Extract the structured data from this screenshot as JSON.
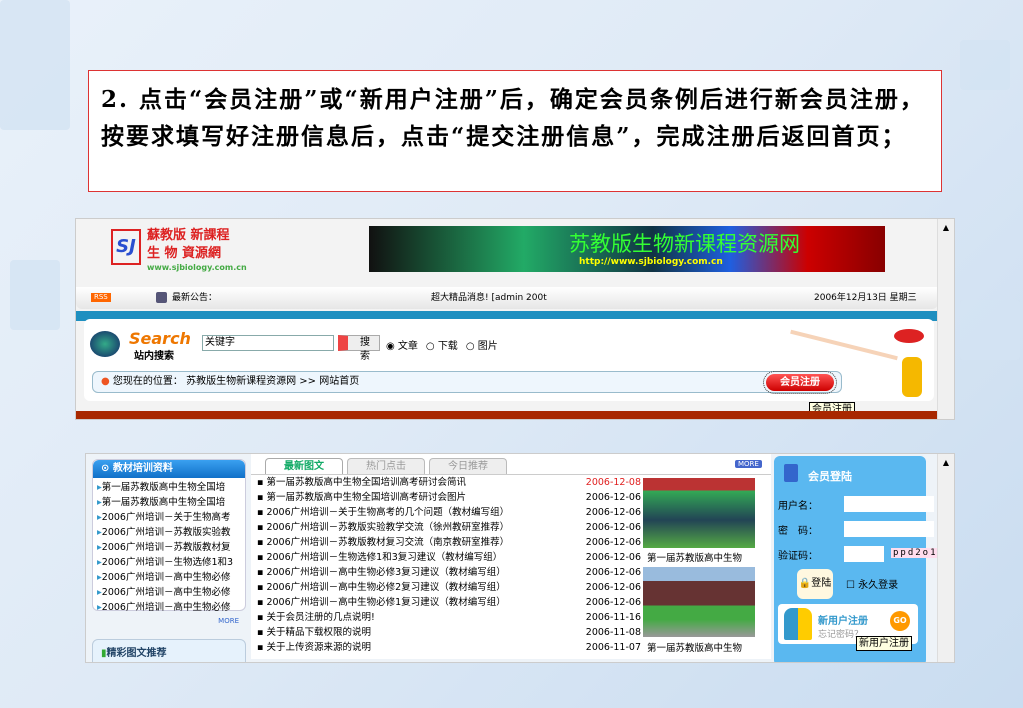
{
  "caption": "2. 点击“会员注册”或“新用户注册”后，确定会员条例后进行新会员注册，按要求填写好注册信息后，点击“提交注册信息”，完成注册后返回首页；",
  "site": {
    "logo_text": [
      "蘇教版 新課程",
      "生 物 資源網",
      "www.sjbiology.com.cn"
    ],
    "logo_mark": "SJ",
    "banner_title": "苏教版生物新课程资源网",
    "banner_url": "http://www.sjbiology.com.cn",
    "rss": "RSS",
    "notice_label": "最新公告：",
    "notice_text": "超大精品消息! [admin 200t",
    "date": "2006年12月13日 星期三",
    "search": {
      "logo": "Search",
      "subtitle": "站内搜索",
      "keyword": "关键字",
      "button": "搜索",
      "options": [
        "文章",
        "下载",
        "图片"
      ]
    },
    "location_label": "您现在的位置：",
    "breadcrumb": "苏教版生物新课程资源网 >> 网站首页",
    "register_button": "会员注册",
    "register_tooltip": "会员注册"
  },
  "left_panel": {
    "title": "教材培训资料",
    "items": [
      "第一届苏教版高中生物全国培",
      "第一届苏教版高中生物全国培",
      "2006广州培训－关于生物高考",
      "2006广州培训－苏教版实验教",
      "2006广州培训－苏教版教材复",
      "2006广州培训－生物选修1和3",
      "2006广州培训－高中生物必修",
      "2006广州培训－高中生物必修",
      "2006广州培训－高中生物必修"
    ],
    "more": "MORE",
    "second_title": "精彩图文推荐"
  },
  "news": {
    "tabs": [
      "最新图文",
      "热门点击",
      "今日推荐"
    ],
    "more": "MORE",
    "items": [
      {
        "title": "第一届苏教版高中生物全国培训高考研讨会简讯",
        "date": "2006-12-08"
      },
      {
        "title": "第一届苏教版高中生物全国培训高考研讨会图片",
        "date": "2006-12-06"
      },
      {
        "title": "2006广州培训－关于生物高考的几个问题（教材编写组）",
        "date": "2006-12-06"
      },
      {
        "title": "2006广州培训－苏教版实验教学交流（徐州教研室推荐）",
        "date": "2006-12-06"
      },
      {
        "title": "2006广州培训－苏教版教材复习交流（南京教研室推荐）",
        "date": "2006-12-06"
      },
      {
        "title": "2006广州培训－生物选修1和3复习建议（教材编写组）",
        "date": "2006-12-06"
      },
      {
        "title": "2006广州培训－高中生物必修3复习建议（教材编写组）",
        "date": "2006-12-06"
      },
      {
        "title": "2006广州培训－高中生物必修2复习建议（教材编写组）",
        "date": "2006-12-06"
      },
      {
        "title": "2006广州培训－高中生物必修1复习建议（教材编写组）",
        "date": "2006-12-06"
      },
      {
        "title": "关于会员注册的几点说明!",
        "date": "2006-11-16"
      },
      {
        "title": "关于精品下载权限的说明",
        "date": "2006-11-08"
      },
      {
        "title": "关于上传资源来源的说明",
        "date": "2006-11-07"
      }
    ],
    "photo_captions": [
      "第一届苏教版高中生物",
      "第一届苏教版高中生物"
    ],
    "highlight_color": "#e02020"
  },
  "login": {
    "title": "会员登陆",
    "username_label": "用户名：",
    "password_label": "密　码：",
    "captcha_label": "验证码：",
    "captcha": "ppd2o1",
    "login_button": "登陆",
    "remember": "永久登录",
    "register": "新用户注册",
    "go": "GO",
    "forgot": "忘记密码？",
    "tooltip": "新用户注册"
  }
}
